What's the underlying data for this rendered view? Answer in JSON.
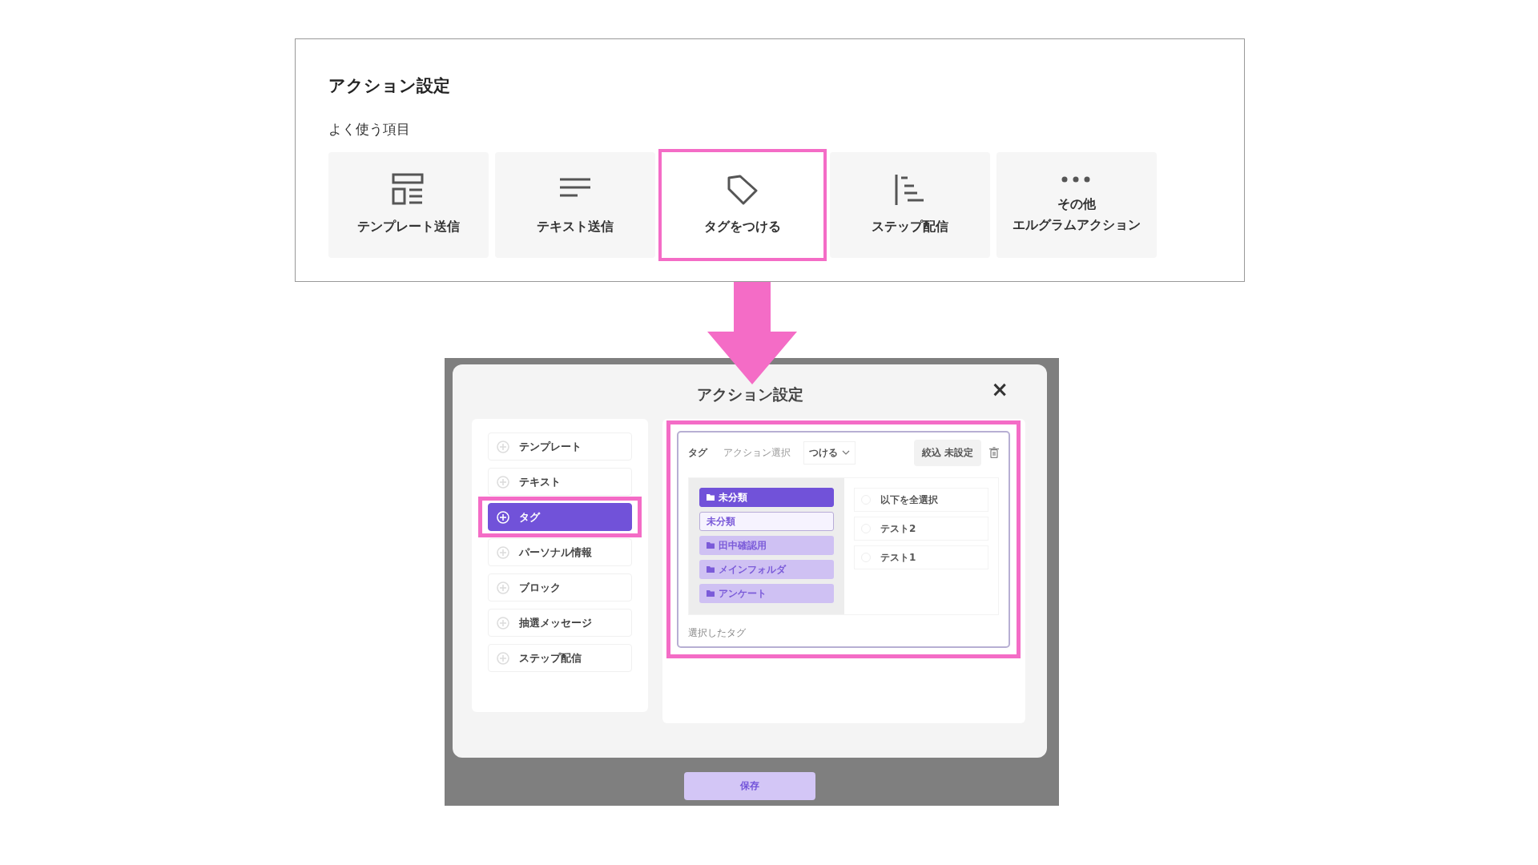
{
  "top_panel": {
    "title": "アクション設定",
    "section_label": "よく使う項目",
    "items": [
      {
        "lines": [
          "テンプレート送信"
        ],
        "kind": "template",
        "highlighted": false
      },
      {
        "lines": [
          "テキスト送信"
        ],
        "kind": "text",
        "highlighted": false
      },
      {
        "lines": [
          "タグをつける"
        ],
        "kind": "tag",
        "highlighted": true
      },
      {
        "lines": [
          "ステップ配信"
        ],
        "kind": "step",
        "highlighted": false
      },
      {
        "lines": [
          "その他",
          "エルグラムアクション"
        ],
        "kind": "more",
        "highlighted": false
      }
    ]
  },
  "modal": {
    "title": "アクション設定",
    "close": "×",
    "menu": [
      {
        "label": "テンプレート",
        "selected": false,
        "highlighted": false
      },
      {
        "label": "テキスト",
        "selected": false,
        "highlighted": false
      },
      {
        "label": "タグ",
        "selected": true,
        "highlighted": true
      },
      {
        "label": "パーソナル情報",
        "selected": false,
        "highlighted": false
      },
      {
        "label": "ブロック",
        "selected": false,
        "highlighted": false
      },
      {
        "label": "抽選メッセージ",
        "selected": false,
        "highlighted": false
      },
      {
        "label": "ステップ配信",
        "selected": false,
        "highlighted": false
      }
    ],
    "tag_editor": {
      "highlighted": true,
      "label": "タグ",
      "action_label": "アクション選択",
      "action_value": "つける",
      "filter_button": "絞込 未設定",
      "folders": [
        {
          "label": "未分類",
          "kind": "folder",
          "selected": true
        },
        {
          "label": "未分類",
          "kind": "subitem",
          "selected": false
        },
        {
          "label": "田中確認用",
          "kind": "folder",
          "selected": false
        },
        {
          "label": "メインフォルダ",
          "kind": "folder",
          "selected": false
        },
        {
          "label": "アンケート",
          "kind": "folder",
          "selected": false
        }
      ],
      "tags": [
        {
          "label": "以下を全選択",
          "checked": false
        },
        {
          "label": "テスト2",
          "checked": false
        },
        {
          "label": "テスト1",
          "checked": false
        }
      ],
      "selected_label": "選択したタグ"
    }
  },
  "save_button": "保存"
}
